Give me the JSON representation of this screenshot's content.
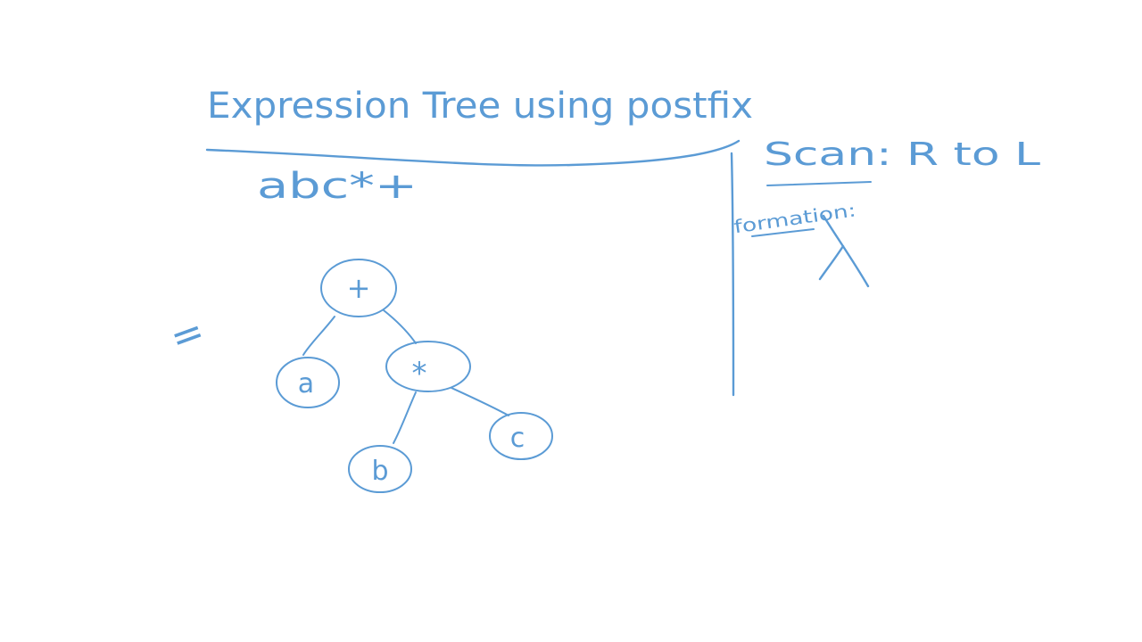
{
  "ink_color": "#5b9bd5",
  "whiteboard": {
    "title": "Expression Tree using postfix",
    "expression": "abc*+",
    "scan_label": "Scan: R to L",
    "formation_label": "formation:",
    "equals_sign": "="
  },
  "tree": {
    "root": "+",
    "left": "a",
    "right": "*",
    "right_left": "b",
    "right_right": "c"
  }
}
